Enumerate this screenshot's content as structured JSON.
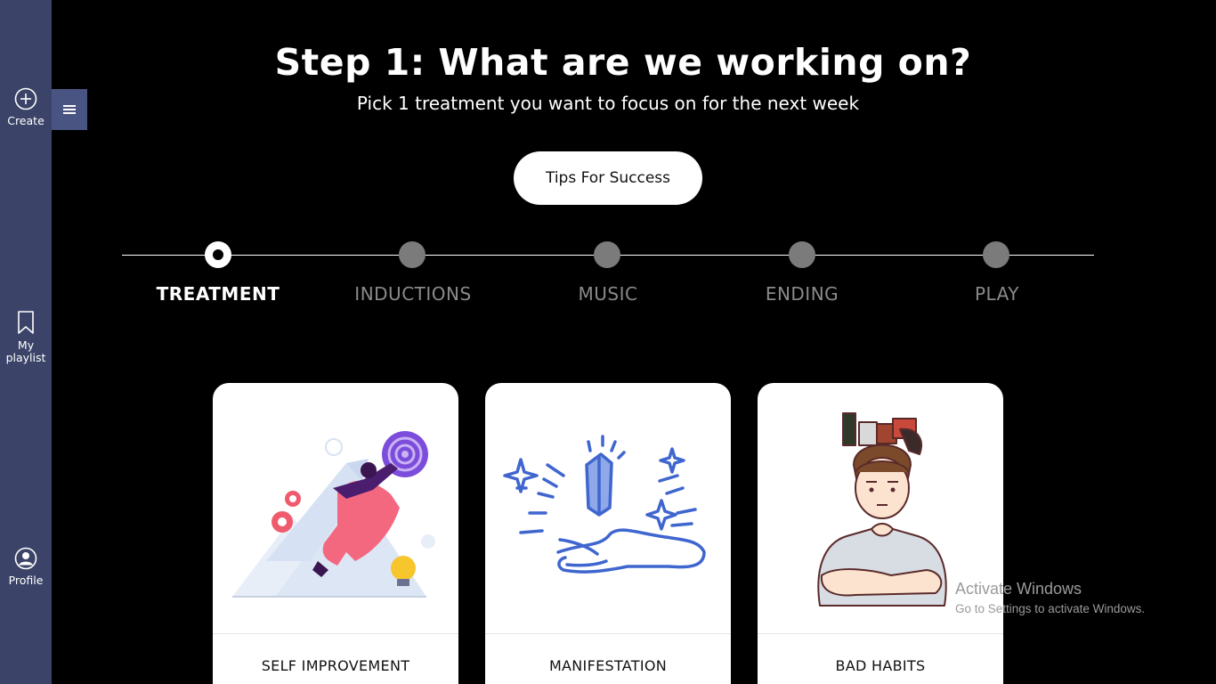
{
  "sidebar": {
    "create_label": "Create",
    "playlist_label": "My playlist",
    "profile_label": "Profile"
  },
  "header": {
    "title": "Step 1: What are we working on?",
    "subtitle": "Pick 1 treatment you want to focus on for the next week",
    "tips_button": "Tips For Success"
  },
  "steps": [
    {
      "label": "TREATMENT",
      "active": true
    },
    {
      "label": "INDUCTIONS",
      "active": false
    },
    {
      "label": "MUSIC",
      "active": false
    },
    {
      "label": "ENDING",
      "active": false
    },
    {
      "label": "PLAY",
      "active": false
    }
  ],
  "cards": [
    {
      "label": "SELF IMPROVEMENT",
      "icon": "self-improvement-illustration"
    },
    {
      "label": "MANIFESTATION",
      "icon": "manifestation-illustration"
    },
    {
      "label": "BAD HABITS",
      "icon": "bad-habits-illustration"
    }
  ],
  "watermark": {
    "title": "Activate Windows",
    "subtitle": "Go to Settings to activate Windows."
  },
  "colors": {
    "sidebar_bg": "#3b4468",
    "toggle_bg": "#4a5482",
    "inactive_step": "#7b7b7b",
    "accent_blue": "#4a6fd1"
  }
}
